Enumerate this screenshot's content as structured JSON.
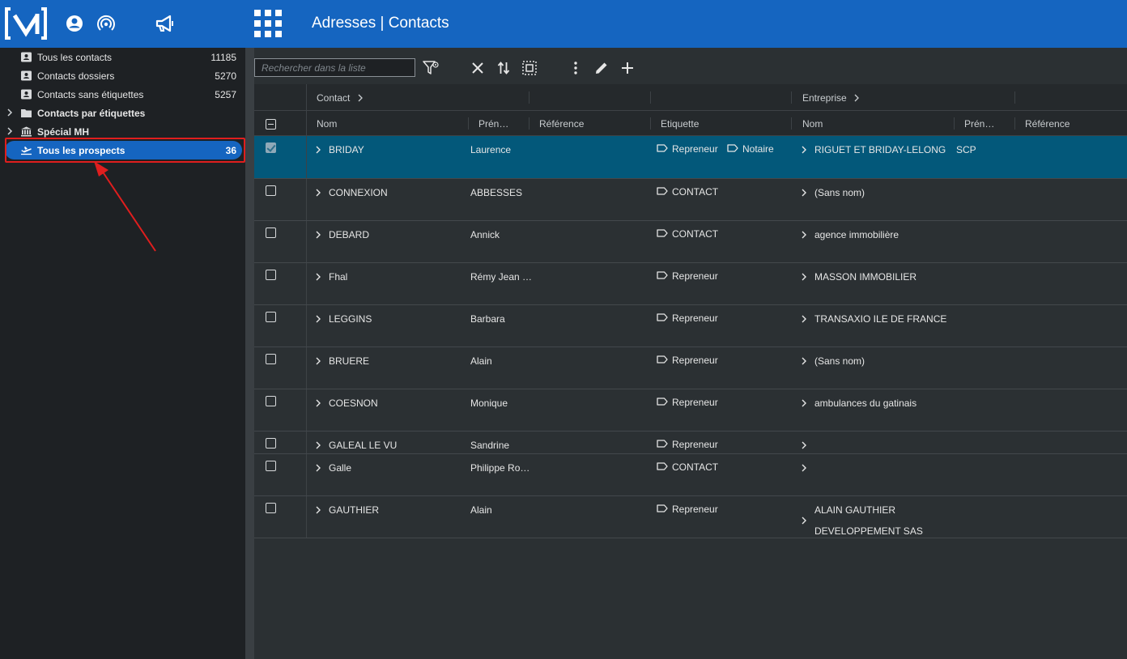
{
  "header": {
    "title": "Adresses | Contacts",
    "icons": [
      "app-logo",
      "account-icon",
      "broadcast-icon",
      "megaphone-icon",
      "apps-grid-icon"
    ]
  },
  "sidebar": {
    "items": [
      {
        "label": "Tous les contacts",
        "count": "11185",
        "icon": "contact-card-icon"
      },
      {
        "label": "Contacts dossiers",
        "count": "5270",
        "icon": "contact-card-icon"
      },
      {
        "label": "Contacts sans étiquettes",
        "count": "5257",
        "icon": "contact-card-icon"
      },
      {
        "label": "Contacts par étiquettes",
        "count": "",
        "icon": "folder-icon"
      },
      {
        "label": "Spécial MH",
        "count": "",
        "icon": "bank-icon"
      },
      {
        "label": "Tous les prospects",
        "count": "36",
        "icon": "plane-icon"
      }
    ]
  },
  "toolbar": {
    "search_placeholder": "Rechercher dans la liste",
    "buttons": [
      "filter-icon",
      "close-icon",
      "sort-icon",
      "select-all-icon",
      "more-vert-icon",
      "edit-icon",
      "add-icon"
    ]
  },
  "grid": {
    "group_headers": {
      "contact": "Contact",
      "entreprise": "Entreprise"
    },
    "columns": {
      "nom": "Nom",
      "prenom": "Prén…",
      "reference": "Référence",
      "etiquette": "Etiquette",
      "ent_nom": "Nom",
      "ent_prenom": "Prén…",
      "ent_reference": "Référence"
    },
    "rows": [
      {
        "nom": "BRIDAY",
        "prenom": "Laurence",
        "tags": [
          "Repreneur",
          "Notaire"
        ],
        "ent_nom": "RIGUET ET BRIDAY-LELONG",
        "ent_nom2": "",
        "ent_prenom": "SCP",
        "checked": true
      },
      {
        "nom": "CONNEXION",
        "prenom": "ABBESSES",
        "tags": [
          "CONTACT"
        ],
        "ent_nom": "(Sans nom)",
        "ent_nom2": "",
        "ent_prenom": "",
        "checked": false
      },
      {
        "nom": "DEBARD",
        "prenom": "Annick",
        "tags": [
          "CONTACT"
        ],
        "ent_nom": "agence immobilière",
        "ent_nom2": "",
        "ent_prenom": "",
        "checked": false
      },
      {
        "nom": "Fhal",
        "prenom": "Rémy Jean …",
        "tags": [
          "Repreneur"
        ],
        "ent_nom": "MASSON IMMOBILIER",
        "ent_nom2": "",
        "ent_prenom": "",
        "checked": false
      },
      {
        "nom": "LEGGINS",
        "prenom": "Barbara",
        "tags": [
          "Repreneur"
        ],
        "ent_nom": "TRANSAXIO ILE DE FRANCE",
        "ent_nom2": "",
        "ent_prenom": "",
        "checked": false
      },
      {
        "nom": "BRUERE",
        "prenom": "Alain",
        "tags": [
          "Repreneur"
        ],
        "ent_nom": "(Sans nom)",
        "ent_nom2": "",
        "ent_prenom": "",
        "checked": false
      },
      {
        "nom": "COESNON",
        "prenom": "Monique",
        "tags": [
          "Repreneur"
        ],
        "ent_nom": "ambulances du gatinais",
        "ent_nom2": "",
        "ent_prenom": "",
        "checked": false
      },
      {
        "nom": "GALEAL LE VU",
        "prenom": "Sandrine",
        "tags": [
          "Repreneur"
        ],
        "ent_nom": "",
        "ent_nom2": "",
        "ent_prenom": "",
        "checked": false
      },
      {
        "nom": "Galle",
        "prenom": "Philippe Ro…",
        "tags": [
          "CONTACT"
        ],
        "ent_nom": "",
        "ent_nom2": "",
        "ent_prenom": "",
        "checked": false
      },
      {
        "nom": "GAUTHIER",
        "prenom": "Alain",
        "tags": [
          "Repreneur"
        ],
        "ent_nom": "ALAIN GAUTHIER",
        "ent_nom2": "DEVELOPPEMENT SAS",
        "ent_prenom": "",
        "checked": false
      }
    ]
  },
  "colors": {
    "brand_blue": "#1565c0",
    "selected_row": "#03587a",
    "annotation_red": "#e01e1e"
  }
}
